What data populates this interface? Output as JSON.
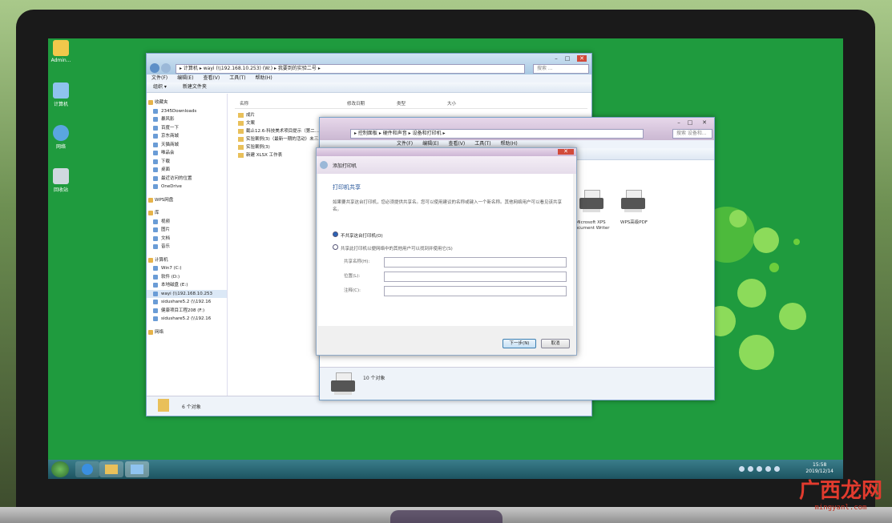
{
  "desktop": {
    "icons": [
      {
        "label": "Admin..."
      },
      {
        "label": "计算机"
      },
      {
        "label": "网络"
      },
      {
        "label": "回收站"
      }
    ]
  },
  "explorer": {
    "address": "▸ 计算机 ▸ wayi (\\\\192.168.10.253) (W:) ▸ 我要到的实验二号 ▸",
    "search_placeholder": "搜索 ...",
    "menu": [
      "文件(F)",
      "编辑(E)",
      "查看(V)",
      "工具(T)",
      "帮助(H)"
    ],
    "toolbar": [
      "组织 ▾",
      "新建文件夹"
    ],
    "nav_favorites_header": "收藏夹",
    "nav_favorites": [
      "2345Downloads",
      "暴风影",
      "百度一下",
      "京东商城",
      "天猫商城",
      "唯品会",
      "下载",
      "桌面",
      "最近访问的位置",
      "OneDrive"
    ],
    "nav_wps": "WPS网盘",
    "nav_libraries_header": "库",
    "nav_libraries": [
      "视频",
      "图片",
      "文档",
      "音乐"
    ],
    "nav_computer_header": "计算机",
    "nav_computer": [
      "Win7 (C:)",
      "软件 (D:)",
      "本地磁盘 (E:)",
      "wayi (\\\\192.168.10.253",
      "sidushare5.2 (\\\\192.16",
      "健康项目工程208 (F:)",
      "sidushare5.2 (\\\\192.16"
    ],
    "nav_network": "网络",
    "columns": [
      "名称",
      "修改日期",
      "类型",
      "大小"
    ],
    "files": [
      "成片",
      "文案",
      "截止12.6-科技美术项目提示（第二...",
      "实验案例(3)（最新一期的活动）未三...",
      "实验案例(3)",
      "新建 XLSX 工作表"
    ],
    "status": "6 个对象"
  },
  "devices_window": {
    "address": "▸ 控制面板 ▸ 硬件和声音 ▸ 设备和打印机 ▸",
    "search_placeholder": "搜索 设备和...",
    "menu": [
      "文件(F)",
      "编辑(E)",
      "查看(V)",
      "工具(T)",
      "帮助(H)"
    ],
    "printers": [
      {
        "label": "Microsoft XPS Document Writer"
      },
      {
        "label": "WPS高级PDF"
      }
    ],
    "status": "10 个对象"
  },
  "dialog": {
    "title": "添加打印机",
    "heading": "打印机共享",
    "description": "如果要共享这台打印机，您必须提供共享名。您可以使用建议的名称或键入一个新名称。其他网络用户可以看见该共享名。",
    "option_no_share": "不共享这台打印机(O)",
    "option_share": "共享此打印机以便网络中的其他用户可以找到并使用它(S)",
    "field_share_name": "共享名称(H):",
    "field_location": "位置(L):",
    "field_comment": "注释(C):",
    "next_button": "下一步(N)",
    "cancel_button": "取消"
  },
  "taskbar": {
    "time": "15:58",
    "date": "2019/12/14"
  },
  "watermark": {
    "text": "广西龙网",
    "url": "mingyanl.com"
  }
}
